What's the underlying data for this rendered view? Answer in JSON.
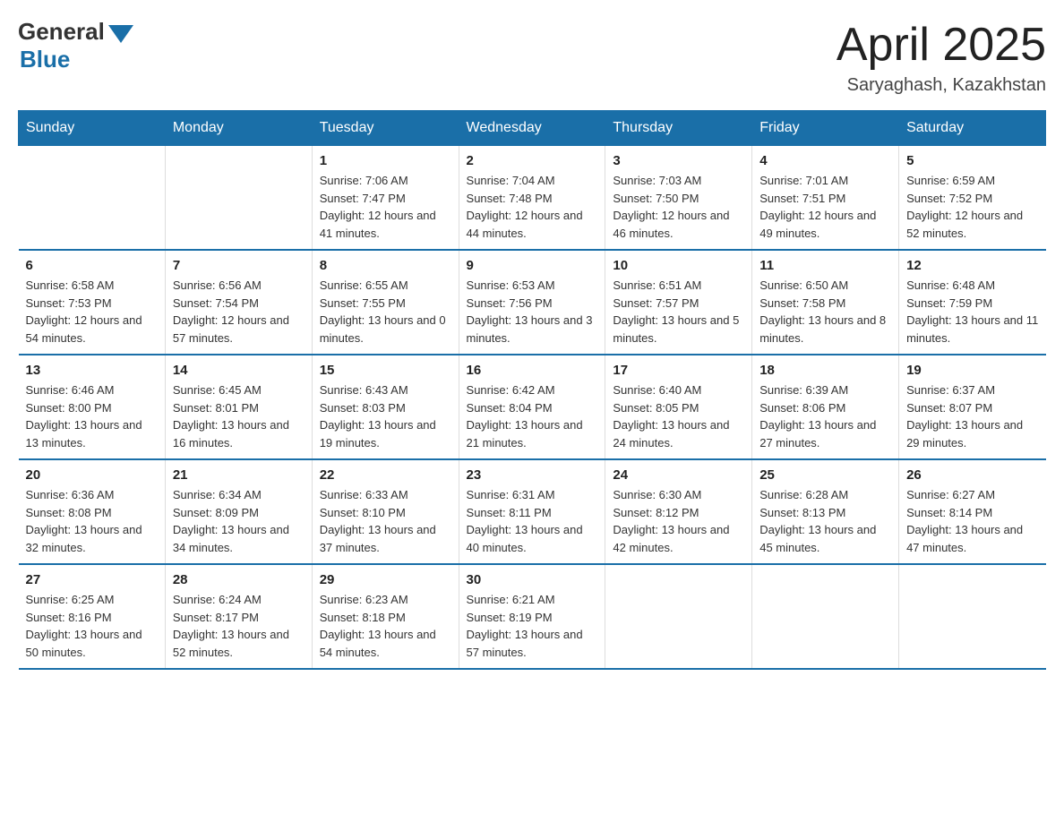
{
  "header": {
    "logo_general": "General",
    "logo_blue": "Blue",
    "month_title": "April 2025",
    "location": "Saryaghash, Kazakhstan"
  },
  "weekdays": [
    "Sunday",
    "Monday",
    "Tuesday",
    "Wednesday",
    "Thursday",
    "Friday",
    "Saturday"
  ],
  "weeks": [
    [
      {
        "day": "",
        "sunrise": "",
        "sunset": "",
        "daylight": ""
      },
      {
        "day": "",
        "sunrise": "",
        "sunset": "",
        "daylight": ""
      },
      {
        "day": "1",
        "sunrise": "Sunrise: 7:06 AM",
        "sunset": "Sunset: 7:47 PM",
        "daylight": "Daylight: 12 hours and 41 minutes."
      },
      {
        "day": "2",
        "sunrise": "Sunrise: 7:04 AM",
        "sunset": "Sunset: 7:48 PM",
        "daylight": "Daylight: 12 hours and 44 minutes."
      },
      {
        "day": "3",
        "sunrise": "Sunrise: 7:03 AM",
        "sunset": "Sunset: 7:50 PM",
        "daylight": "Daylight: 12 hours and 46 minutes."
      },
      {
        "day": "4",
        "sunrise": "Sunrise: 7:01 AM",
        "sunset": "Sunset: 7:51 PM",
        "daylight": "Daylight: 12 hours and 49 minutes."
      },
      {
        "day": "5",
        "sunrise": "Sunrise: 6:59 AM",
        "sunset": "Sunset: 7:52 PM",
        "daylight": "Daylight: 12 hours and 52 minutes."
      }
    ],
    [
      {
        "day": "6",
        "sunrise": "Sunrise: 6:58 AM",
        "sunset": "Sunset: 7:53 PM",
        "daylight": "Daylight: 12 hours and 54 minutes."
      },
      {
        "day": "7",
        "sunrise": "Sunrise: 6:56 AM",
        "sunset": "Sunset: 7:54 PM",
        "daylight": "Daylight: 12 hours and 57 minutes."
      },
      {
        "day": "8",
        "sunrise": "Sunrise: 6:55 AM",
        "sunset": "Sunset: 7:55 PM",
        "daylight": "Daylight: 13 hours and 0 minutes."
      },
      {
        "day": "9",
        "sunrise": "Sunrise: 6:53 AM",
        "sunset": "Sunset: 7:56 PM",
        "daylight": "Daylight: 13 hours and 3 minutes."
      },
      {
        "day": "10",
        "sunrise": "Sunrise: 6:51 AM",
        "sunset": "Sunset: 7:57 PM",
        "daylight": "Daylight: 13 hours and 5 minutes."
      },
      {
        "day": "11",
        "sunrise": "Sunrise: 6:50 AM",
        "sunset": "Sunset: 7:58 PM",
        "daylight": "Daylight: 13 hours and 8 minutes."
      },
      {
        "day": "12",
        "sunrise": "Sunrise: 6:48 AM",
        "sunset": "Sunset: 7:59 PM",
        "daylight": "Daylight: 13 hours and 11 minutes."
      }
    ],
    [
      {
        "day": "13",
        "sunrise": "Sunrise: 6:46 AM",
        "sunset": "Sunset: 8:00 PM",
        "daylight": "Daylight: 13 hours and 13 minutes."
      },
      {
        "day": "14",
        "sunrise": "Sunrise: 6:45 AM",
        "sunset": "Sunset: 8:01 PM",
        "daylight": "Daylight: 13 hours and 16 minutes."
      },
      {
        "day": "15",
        "sunrise": "Sunrise: 6:43 AM",
        "sunset": "Sunset: 8:03 PM",
        "daylight": "Daylight: 13 hours and 19 minutes."
      },
      {
        "day": "16",
        "sunrise": "Sunrise: 6:42 AM",
        "sunset": "Sunset: 8:04 PM",
        "daylight": "Daylight: 13 hours and 21 minutes."
      },
      {
        "day": "17",
        "sunrise": "Sunrise: 6:40 AM",
        "sunset": "Sunset: 8:05 PM",
        "daylight": "Daylight: 13 hours and 24 minutes."
      },
      {
        "day": "18",
        "sunrise": "Sunrise: 6:39 AM",
        "sunset": "Sunset: 8:06 PM",
        "daylight": "Daylight: 13 hours and 27 minutes."
      },
      {
        "day": "19",
        "sunrise": "Sunrise: 6:37 AM",
        "sunset": "Sunset: 8:07 PM",
        "daylight": "Daylight: 13 hours and 29 minutes."
      }
    ],
    [
      {
        "day": "20",
        "sunrise": "Sunrise: 6:36 AM",
        "sunset": "Sunset: 8:08 PM",
        "daylight": "Daylight: 13 hours and 32 minutes."
      },
      {
        "day": "21",
        "sunrise": "Sunrise: 6:34 AM",
        "sunset": "Sunset: 8:09 PM",
        "daylight": "Daylight: 13 hours and 34 minutes."
      },
      {
        "day": "22",
        "sunrise": "Sunrise: 6:33 AM",
        "sunset": "Sunset: 8:10 PM",
        "daylight": "Daylight: 13 hours and 37 minutes."
      },
      {
        "day": "23",
        "sunrise": "Sunrise: 6:31 AM",
        "sunset": "Sunset: 8:11 PM",
        "daylight": "Daylight: 13 hours and 40 minutes."
      },
      {
        "day": "24",
        "sunrise": "Sunrise: 6:30 AM",
        "sunset": "Sunset: 8:12 PM",
        "daylight": "Daylight: 13 hours and 42 minutes."
      },
      {
        "day": "25",
        "sunrise": "Sunrise: 6:28 AM",
        "sunset": "Sunset: 8:13 PM",
        "daylight": "Daylight: 13 hours and 45 minutes."
      },
      {
        "day": "26",
        "sunrise": "Sunrise: 6:27 AM",
        "sunset": "Sunset: 8:14 PM",
        "daylight": "Daylight: 13 hours and 47 minutes."
      }
    ],
    [
      {
        "day": "27",
        "sunrise": "Sunrise: 6:25 AM",
        "sunset": "Sunset: 8:16 PM",
        "daylight": "Daylight: 13 hours and 50 minutes."
      },
      {
        "day": "28",
        "sunrise": "Sunrise: 6:24 AM",
        "sunset": "Sunset: 8:17 PM",
        "daylight": "Daylight: 13 hours and 52 minutes."
      },
      {
        "day": "29",
        "sunrise": "Sunrise: 6:23 AM",
        "sunset": "Sunset: 8:18 PM",
        "daylight": "Daylight: 13 hours and 54 minutes."
      },
      {
        "day": "30",
        "sunrise": "Sunrise: 6:21 AM",
        "sunset": "Sunset: 8:19 PM",
        "daylight": "Daylight: 13 hours and 57 minutes."
      },
      {
        "day": "",
        "sunrise": "",
        "sunset": "",
        "daylight": ""
      },
      {
        "day": "",
        "sunrise": "",
        "sunset": "",
        "daylight": ""
      },
      {
        "day": "",
        "sunrise": "",
        "sunset": "",
        "daylight": ""
      }
    ]
  ]
}
